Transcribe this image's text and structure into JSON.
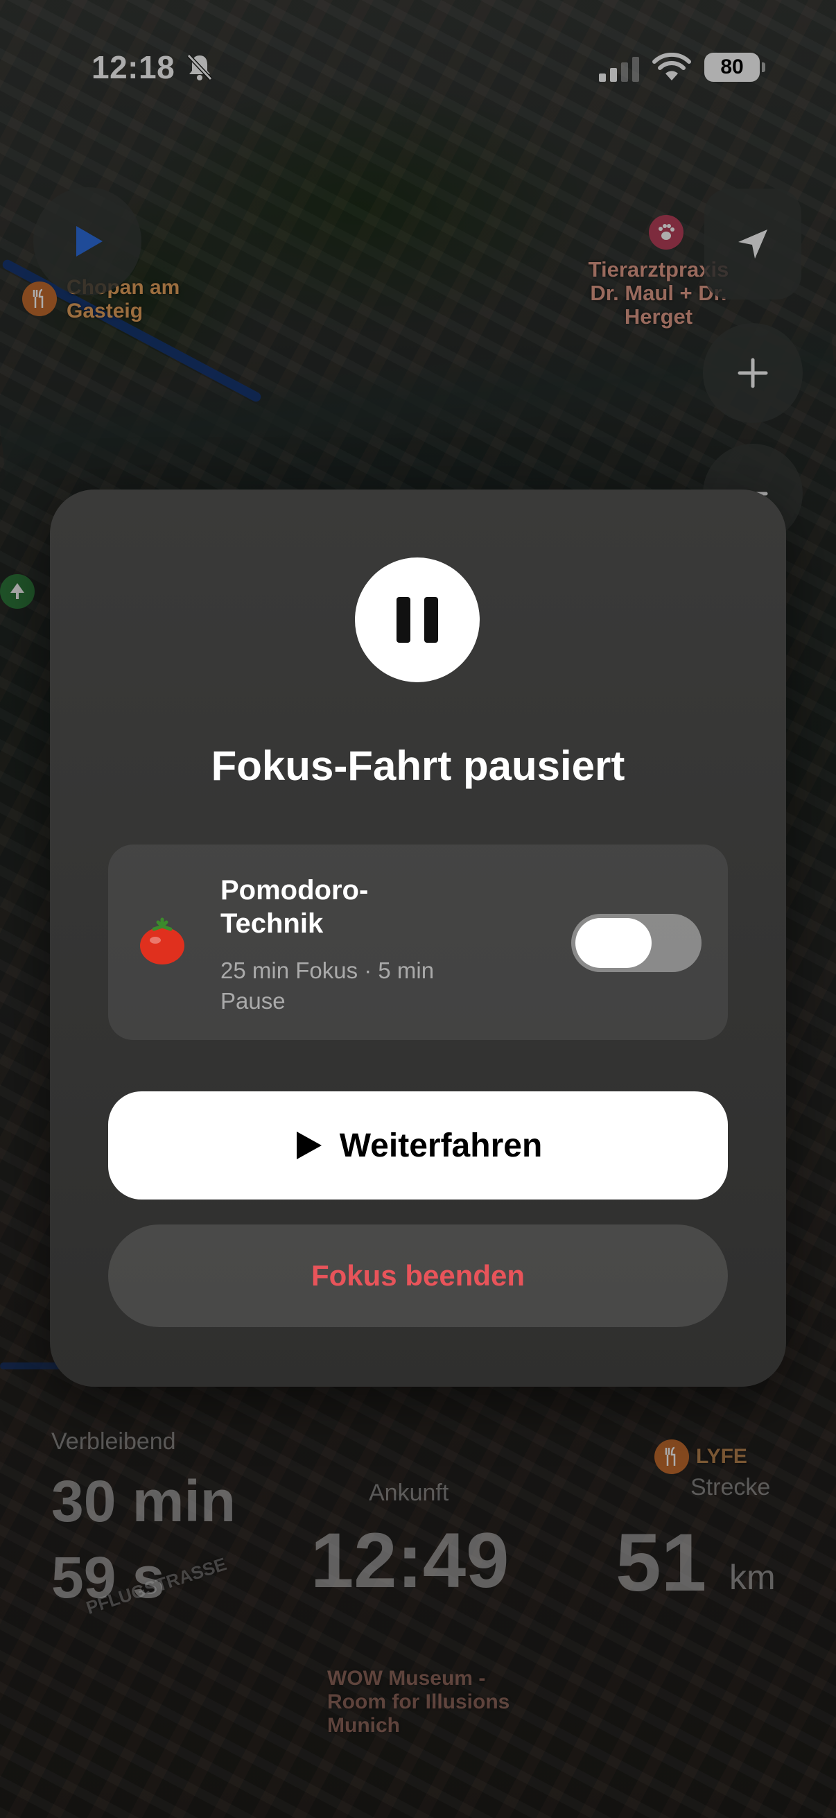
{
  "status_bar": {
    "time": "12:18",
    "battery": "80"
  },
  "map": {
    "poi": {
      "restaurant_name": "Chopan am Gasteig",
      "vet_name": "Tierarztpraxis Dr. Maul + Dr. Herget",
      "lyfe": "LYFE",
      "museum": "WOW Museum - Room for Illusions Munich",
      "street": "PFLUGSTRASSE"
    },
    "route_color": "#1d52b8"
  },
  "trip_stats": {
    "remaining_label": "Verbleibend",
    "remaining_value": "30 min\n59 s",
    "arrival_label": "Ankunft",
    "arrival_value": "12:49",
    "distance_label": "Strecke",
    "distance_value": "51",
    "distance_unit": "km"
  },
  "modal": {
    "title": "Fokus-Fahrt pausiert",
    "technique": {
      "emoji": "🍅",
      "name": "Pomodoro-Technik",
      "description": "25 min Fokus · 5 min Pause",
      "toggle_on": false
    },
    "continue_button": "Weiterfahren",
    "end_button": "Fokus beenden"
  },
  "colors": {
    "end_button_text": "#e8545a",
    "modal_background": "#363635"
  }
}
